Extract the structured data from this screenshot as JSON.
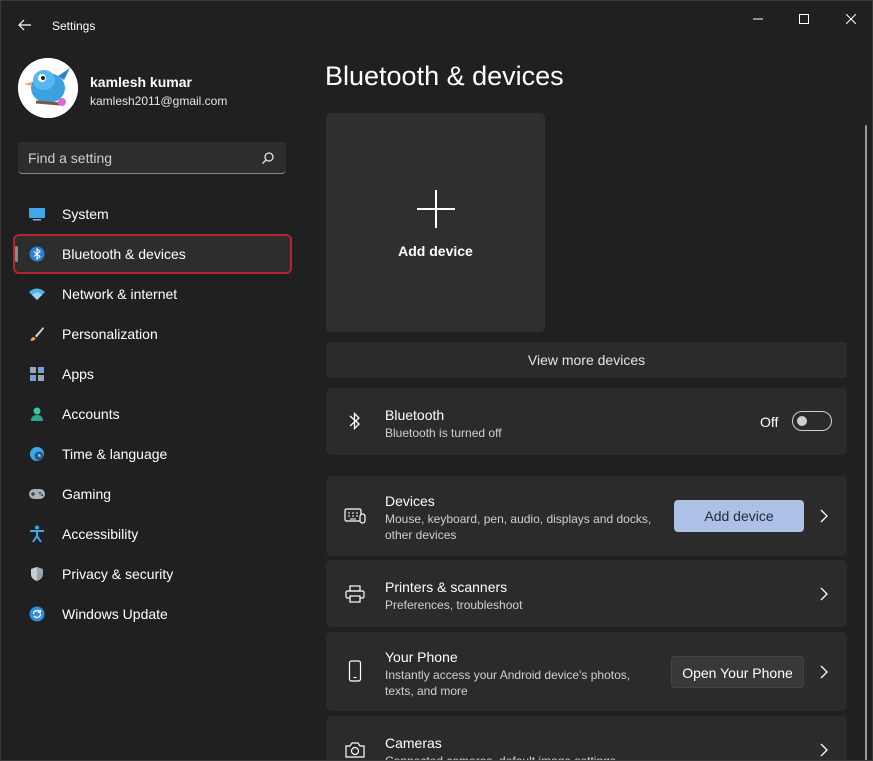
{
  "window": {
    "title": "Settings"
  },
  "profile": {
    "name": "kamlesh kumar",
    "email": "kamlesh2011@gmail.com"
  },
  "search": {
    "placeholder": "Find a setting",
    "icon": "search-icon"
  },
  "nav": {
    "items": [
      {
        "label": "System",
        "icon": "monitor-icon"
      },
      {
        "label": "Bluetooth & devices",
        "icon": "bluetooth-icon",
        "active": true
      },
      {
        "label": "Network & internet",
        "icon": "wifi-icon"
      },
      {
        "label": "Personalization",
        "icon": "brush-icon"
      },
      {
        "label": "Apps",
        "icon": "apps-icon"
      },
      {
        "label": "Accounts",
        "icon": "person-icon"
      },
      {
        "label": "Time & language",
        "icon": "globe-clock-icon"
      },
      {
        "label": "Gaming",
        "icon": "gamepad-icon"
      },
      {
        "label": "Accessibility",
        "icon": "accessibility-icon"
      },
      {
        "label": "Privacy & security",
        "icon": "shield-icon"
      },
      {
        "label": "Windows Update",
        "icon": "sync-icon"
      }
    ]
  },
  "main": {
    "title": "Bluetooth & devices",
    "add_tile_label": "Add device",
    "view_more": "View more devices",
    "bluetooth": {
      "title": "Bluetooth",
      "subtitle": "Bluetooth is turned off",
      "toggle_label": "Off",
      "toggle_on": false
    },
    "devices": {
      "title": "Devices",
      "subtitle_line1": "Mouse, keyboard, pen, audio, displays and docks,",
      "subtitle_line2": "other devices",
      "button": "Add device"
    },
    "printers": {
      "title": "Printers & scanners",
      "subtitle": "Preferences, troubleshoot"
    },
    "phone": {
      "title": "Your Phone",
      "subtitle_line1": "Instantly access your Android device's photos,",
      "subtitle_line2": "texts, and more",
      "button": "Open Your Phone"
    },
    "cameras": {
      "title": "Cameras",
      "subtitle": "Connected cameras, default image settings"
    }
  },
  "colors": {
    "background": "#202020",
    "card": "#2b2b2b",
    "accent_button": "#adc0e6",
    "highlight_outline": "#b3262e"
  }
}
